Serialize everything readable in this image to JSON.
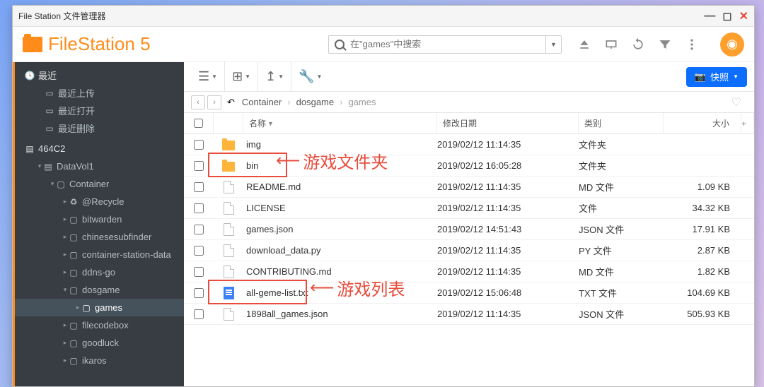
{
  "window": {
    "title": "File Station 文件管理器"
  },
  "app": {
    "name": "FileStation 5"
  },
  "search": {
    "placeholder": "在\"games\"中搜索"
  },
  "snapshot_label": "快照",
  "sidebar": {
    "recent_label": "最近",
    "recent_items": [
      "最近上传",
      "最近打开",
      "最近删除"
    ],
    "volume_label": "464C2",
    "volume_name": "DataVol1",
    "tree": [
      {
        "label": "Container",
        "depth": 0,
        "expanded": true,
        "icon": "folder",
        "active": false
      },
      {
        "label": "@Recycle",
        "depth": 1,
        "expanded": false,
        "icon": "recycle",
        "active": false
      },
      {
        "label": "bitwarden",
        "depth": 1,
        "expanded": false,
        "icon": "folder",
        "active": false
      },
      {
        "label": "chinesesubfinder",
        "depth": 1,
        "expanded": false,
        "icon": "folder",
        "active": false
      },
      {
        "label": "container-station-data",
        "depth": 1,
        "expanded": false,
        "icon": "folder",
        "active": false
      },
      {
        "label": "ddns-go",
        "depth": 1,
        "expanded": false,
        "icon": "folder",
        "active": false
      },
      {
        "label": "dosgame",
        "depth": 1,
        "expanded": true,
        "icon": "folder",
        "active": false
      },
      {
        "label": "games",
        "depth": 2,
        "expanded": false,
        "icon": "folder",
        "active": true
      },
      {
        "label": "filecodebox",
        "depth": 1,
        "expanded": false,
        "icon": "folder",
        "active": false
      },
      {
        "label": "goodluck",
        "depth": 1,
        "expanded": false,
        "icon": "folder",
        "active": false
      },
      {
        "label": "ikaros",
        "depth": 1,
        "expanded": false,
        "icon": "folder",
        "active": false
      }
    ]
  },
  "breadcrumbs": [
    "Container",
    "dosgame",
    "games"
  ],
  "columns": {
    "name": "名称",
    "date": "修改日期",
    "type": "类别",
    "size": "大小",
    "plus": "+"
  },
  "files": [
    {
      "name": "img",
      "date": "2019/02/12 11:14:35",
      "type": "文件夹",
      "size": "",
      "icon": "folder"
    },
    {
      "name": "bin",
      "date": "2019/02/12 16:05:28",
      "type": "文件夹",
      "size": "",
      "icon": "folder"
    },
    {
      "name": "README.md",
      "date": "2019/02/12 11:14:35",
      "type": "MD 文件",
      "size": "1.09 KB",
      "icon": "file"
    },
    {
      "name": "LICENSE",
      "date": "2019/02/12 11:14:35",
      "type": "文件",
      "size": "34.32 KB",
      "icon": "file"
    },
    {
      "name": "games.json",
      "date": "2019/02/12 14:51:43",
      "type": "JSON 文件",
      "size": "17.91 KB",
      "icon": "file"
    },
    {
      "name": "download_data.py",
      "date": "2019/02/12 11:14:35",
      "type": "PY 文件",
      "size": "2.87 KB",
      "icon": "file"
    },
    {
      "name": "CONTRIBUTING.md",
      "date": "2019/02/12 11:14:35",
      "type": "MD 文件",
      "size": "1.82 KB",
      "icon": "file"
    },
    {
      "name": "all-geme-list.txt",
      "date": "2019/02/12 15:06:48",
      "type": "TXT 文件",
      "size": "104.69 KB",
      "icon": "txt"
    },
    {
      "name": "1898all_games.json",
      "date": "2019/02/12 11:14:35",
      "type": "JSON 文件",
      "size": "505.93 KB",
      "icon": "file"
    }
  ],
  "annotations": {
    "folder_label": "游戏文件夹",
    "list_label": "游戏列表"
  }
}
